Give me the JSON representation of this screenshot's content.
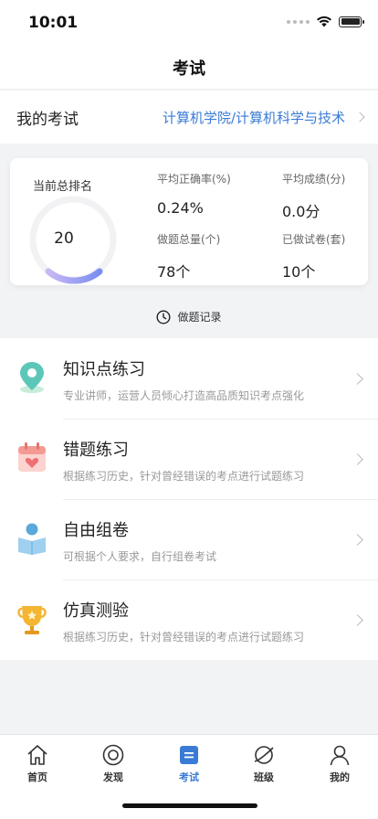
{
  "status_bar": {
    "time": "10:01"
  },
  "nav": {
    "title": "考试"
  },
  "my_exam": {
    "label": "我的考试",
    "value": "计算机学院/计算机科学与技术"
  },
  "stats": {
    "rank_label": "当前总排名",
    "rank_value": "20",
    "accuracy_label": "平均正确率(%)",
    "accuracy_value": "0.24%",
    "avg_score_label": "平均成绩(分)",
    "avg_score_value": "0.0分",
    "total_questions_label": "做题总量(个)",
    "total_questions_value": "78个",
    "papers_label": "已做试卷(套)",
    "papers_value": "10个"
  },
  "history": {
    "label": "做题记录"
  },
  "practice_items": [
    {
      "title": "知识点练习",
      "desc": "专业讲师，运营人员倾心打造高品质知识考点强化",
      "icon": "map-pin-icon"
    },
    {
      "title": "错题练习",
      "desc": "根据练习历史，针对曾经错误的考点进行试题练习",
      "icon": "calendar-heart-icon"
    },
    {
      "title": "自由组卷",
      "desc": "可根据个人要求，自行组卷考试",
      "icon": "reader-icon"
    },
    {
      "title": "仿真测验",
      "desc": "根据练习历史，针对曾经错误的考点进行试题练习",
      "icon": "trophy-icon"
    }
  ],
  "tabs": [
    {
      "label": "首页",
      "icon": "home-icon"
    },
    {
      "label": "发现",
      "icon": "discover-icon"
    },
    {
      "label": "考试",
      "icon": "exam-icon",
      "active": true
    },
    {
      "label": "班级",
      "icon": "class-icon"
    },
    {
      "label": "我的",
      "icon": "profile-icon"
    }
  ],
  "colors": {
    "accent": "#3a7bd5",
    "ring_gradient_start": "#c9b8f5",
    "ring_gradient_end": "#7a8ef0"
  }
}
